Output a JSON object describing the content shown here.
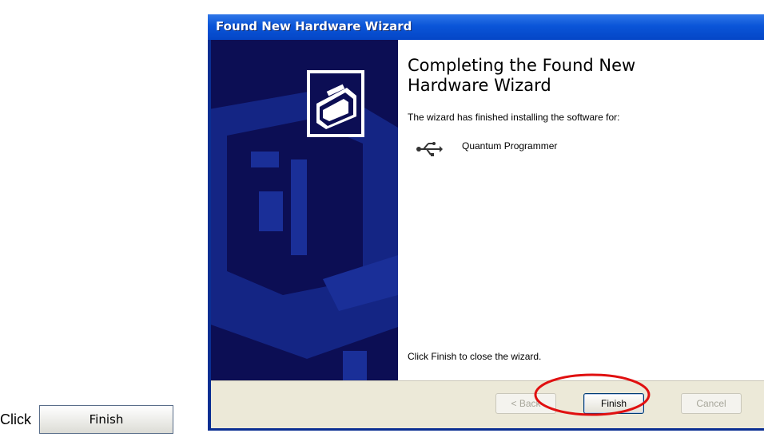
{
  "window": {
    "title": "Found New Hardware Wizard"
  },
  "content": {
    "heading_line1": "Completing the Found New",
    "heading_line2": "Hardware Wizard",
    "intro": "The wizard has finished installing the software for:",
    "device_name": "Quantum Programmer",
    "closing": "Click Finish to close the wizard."
  },
  "buttons": {
    "back": "< Back",
    "finish": "Finish",
    "cancel": "Cancel"
  },
  "instruction": {
    "click_label": "Click",
    "finish_sample": "Finish"
  },
  "colors": {
    "title_bar": "#0a55d8",
    "side_panel": "#0c0e54",
    "highlight_circle": "#e01010"
  }
}
